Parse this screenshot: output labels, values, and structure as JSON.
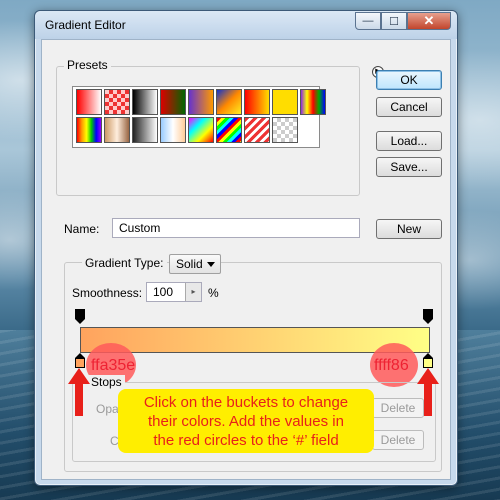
{
  "window": {
    "title": "Gradient Editor",
    "controls": {
      "minimize": "—",
      "maximize": "☐",
      "close": "✕"
    }
  },
  "presets": {
    "legend": "Presets",
    "menu_icon": "triangle-right-icon",
    "swatches": [
      "linear-gradient(90deg,#f00,#fff)",
      "repeating-conic-gradient(#e33 0 25%,#fcc 0 50%) 0 0/8px 8px",
      "linear-gradient(90deg,#000,#fff)",
      "linear-gradient(90deg,#d00,#060)",
      "linear-gradient(90deg,#63c,#f90)",
      "linear-gradient(135deg,#13c,#f80,#fe2)",
      "linear-gradient(90deg,#f00,#fd0)",
      "linear-gradient(90deg,#fd0,#fd0)",
      "linear-gradient(90deg,#8a2be2,#ff0,#f00,#0a0,#00f)",
      "linear-gradient(90deg,#f00,#f90,#ff0,#0c0,#00f,#90f)",
      "linear-gradient(90deg,#c96,#fed,#964)",
      "linear-gradient(90deg,#222,#fff)",
      "linear-gradient(90deg,#9cf,#fff,#fc9)",
      "linear-gradient(135deg,#f0f,#0ff,#ff0,#f00)",
      "repeating-linear-gradient(135deg,#f00 0 3px,#ff0 3px 6px,#0f0 6px 9px,#0ff 9px 12px,#00f 12px 15px)",
      "repeating-linear-gradient(135deg,#e33 0 3px,#fff 3px 6px)",
      "repeating-conic-gradient(#ccc 0 25%,#fff 0 50%) 0 0/8px 8px"
    ]
  },
  "buttons": {
    "ok": "OK",
    "cancel": "Cancel",
    "load": "Load...",
    "save": "Save...",
    "new": "New"
  },
  "name": {
    "label": "Name:",
    "value": "Custom"
  },
  "gradient_type": {
    "label": "Gradient Type:",
    "value": "Solid"
  },
  "smoothness": {
    "label": "Smoothness:",
    "value": "100",
    "unit": "%"
  },
  "stops": {
    "legend": "Stops",
    "opacity_label": "Opa",
    "color_label": "Co",
    "delete_label": "Delete",
    "left_color": "#ffa35e",
    "right_color": "#ffff86"
  },
  "annotations": {
    "left_hex": "ffa35e",
    "right_hex": "ffff86",
    "callout_line1": "Click on the buckets to change",
    "callout_line2": "their colors. Add the values in",
    "callout_line3": "the red circles to the ‘#’ field"
  }
}
